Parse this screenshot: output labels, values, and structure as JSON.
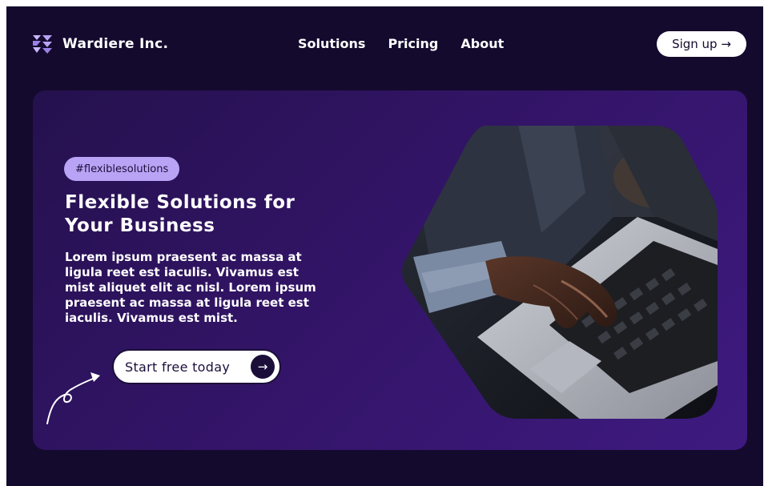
{
  "nav": {
    "brand_name": "Wardiere Inc.",
    "links": [
      {
        "label": "Solutions"
      },
      {
        "label": "Pricing"
      },
      {
        "label": "About"
      }
    ],
    "signup_label": "Sign up →"
  },
  "hero": {
    "tag": "#flexiblesolutions",
    "title_line1": "Flexible Solutions for",
    "title_line2": "Your Business",
    "description": "Lorem ipsum praesent ac massa at ligula reet est iaculis. Vivamus est mist aliquet elit ac nisl. Lorem ipsum praesent ac massa at ligula reet est iaculis. Vivamus est mist.",
    "cta_label": "Start free today",
    "cta_icon": "arrow-right-icon"
  },
  "colors": {
    "background": "#140a2e",
    "hero_gradient_start": "#25114e",
    "hero_gradient_end": "#3e1a80",
    "tag_bg": "#b9a3f5",
    "button_bg": "#ffffff",
    "text_dark": "#1b0f3a"
  }
}
